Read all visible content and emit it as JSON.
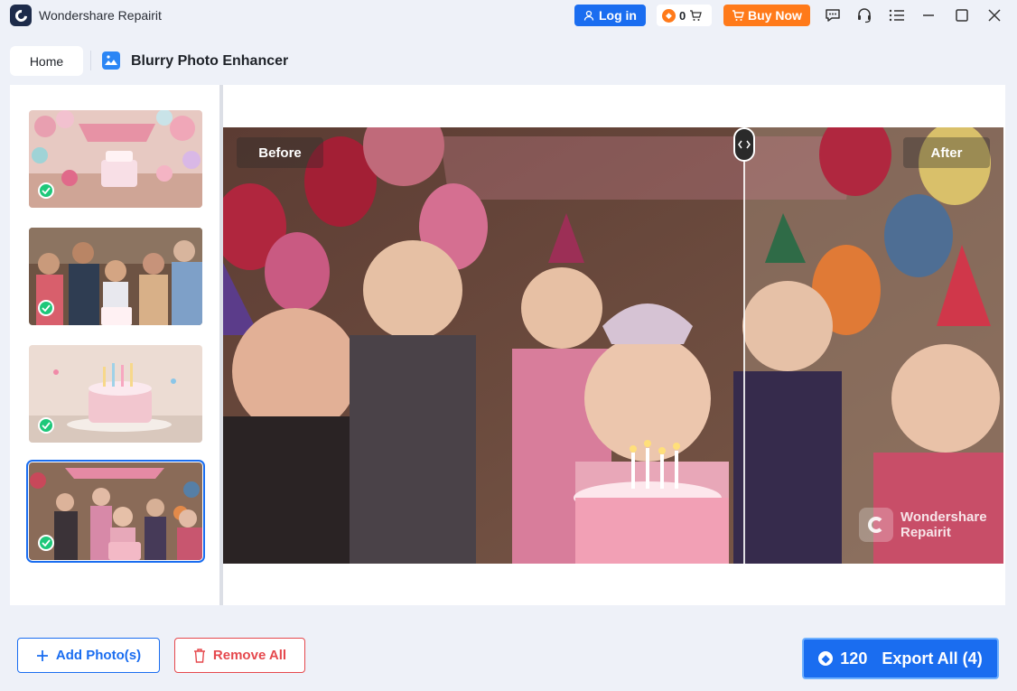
{
  "app": {
    "title": "Wondershare Repairit"
  },
  "titlebar": {
    "login_label": "Log in",
    "credits": "0",
    "buy_label": "Buy Now",
    "icons": [
      "chat-icon",
      "support-headset-icon",
      "menu-icon",
      "minimize-icon",
      "maximize-icon",
      "close-icon"
    ]
  },
  "breadcrumb": {
    "home_label": "Home",
    "tool_title": "Blurry Photo Enhancer"
  },
  "thumbnails": [
    {
      "name": "birthday-party-table-decor",
      "status": "done"
    },
    {
      "name": "family-birthday-celebration",
      "status": "done"
    },
    {
      "name": "birthday-cake-candles",
      "status": "done"
    },
    {
      "name": "kids-birthday-party",
      "status": "done",
      "selected": true
    }
  ],
  "preview": {
    "before_label": "Before",
    "after_label": "After",
    "watermark_line1": "Wondershare",
    "watermark_line2": "Repairit"
  },
  "bottombar": {
    "add_label": "Add Photo(s)",
    "remove_label": "Remove All",
    "export_credits": "120",
    "export_label": "Export All (4)"
  },
  "colors": {
    "accent": "#1a6df0",
    "buy": "#ff7a1a",
    "danger": "#e5484d",
    "success": "#1ec87a"
  }
}
